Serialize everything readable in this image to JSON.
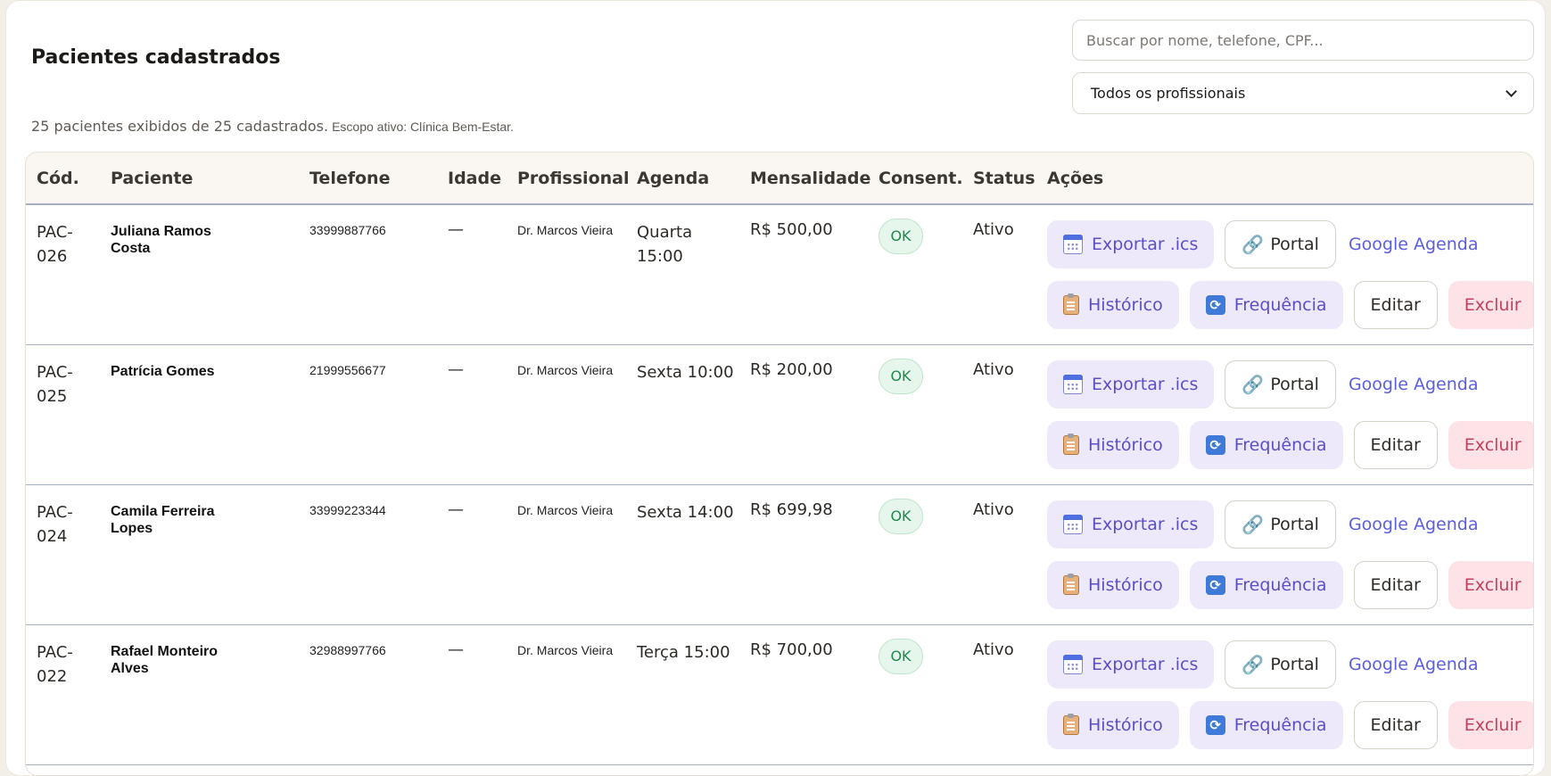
{
  "page": {
    "title": "Pacientes cadastrados",
    "summary": "25 pacientes exibidos de 25 cadastrados.",
    "scope": "Escopo ativo: Clínica Bem-Estar."
  },
  "search": {
    "placeholder": "Buscar por nome, telefone, CPF..."
  },
  "filter": {
    "selected": "Todos os profissionais"
  },
  "table": {
    "headers": [
      "Cód.",
      "Paciente",
      "Telefone",
      "Idade",
      "Profissional",
      "Agenda",
      "Mensalidade",
      "Consent.",
      "Status",
      "Ações"
    ],
    "rows": [
      {
        "code": "PAC-\n026",
        "name": "Juliana Ramos\nCosta",
        "phone": "33999887766",
        "age": "—",
        "professional": "Dr. Marcos Vieira",
        "schedule": "Quarta\n15:00",
        "fee": "R$ 500,00",
        "consent": "OK",
        "status": "Ativo"
      },
      {
        "code": "PAC-\n025",
        "name": "Patrícia Gomes",
        "phone": "21999556677",
        "age": "—",
        "professional": "Dr. Marcos Vieira",
        "schedule": "Sexta 10:00",
        "fee": "R$ 200,00",
        "consent": "OK",
        "status": "Ativo"
      },
      {
        "code": "PAC-\n024",
        "name": "Camila Ferreira\nLopes",
        "phone": "33999223344",
        "age": "—",
        "professional": "Dr. Marcos Vieira",
        "schedule": "Sexta 14:00",
        "fee": "R$ 699,98",
        "consent": "OK",
        "status": "Ativo"
      },
      {
        "code": "PAC-\n022",
        "name": "Rafael Monteiro\nAlves",
        "phone": "32988997766",
        "age": "—",
        "professional": "Dr. Marcos Vieira",
        "schedule": "Terça 15:00",
        "fee": "R$ 700,00",
        "consent": "OK",
        "status": "Ativo"
      }
    ]
  },
  "actions": {
    "export": "Exportar .ics",
    "portal": "Portal",
    "google": "Google Agenda",
    "history": "Histórico",
    "frequency": "Frequência",
    "edit": "Editar",
    "delete": "Excluir"
  },
  "icons": {
    "export": "calendar-icon",
    "portal": "link-icon",
    "history": "clipboard-icon",
    "frequency": "repeat-icon",
    "filter": "chevron-down-icon"
  },
  "colors": {
    "accent": "#5b4fc7",
    "link": "#5b5ee0",
    "danger": "#c2405c",
    "ok": "#1e8a4c"
  }
}
